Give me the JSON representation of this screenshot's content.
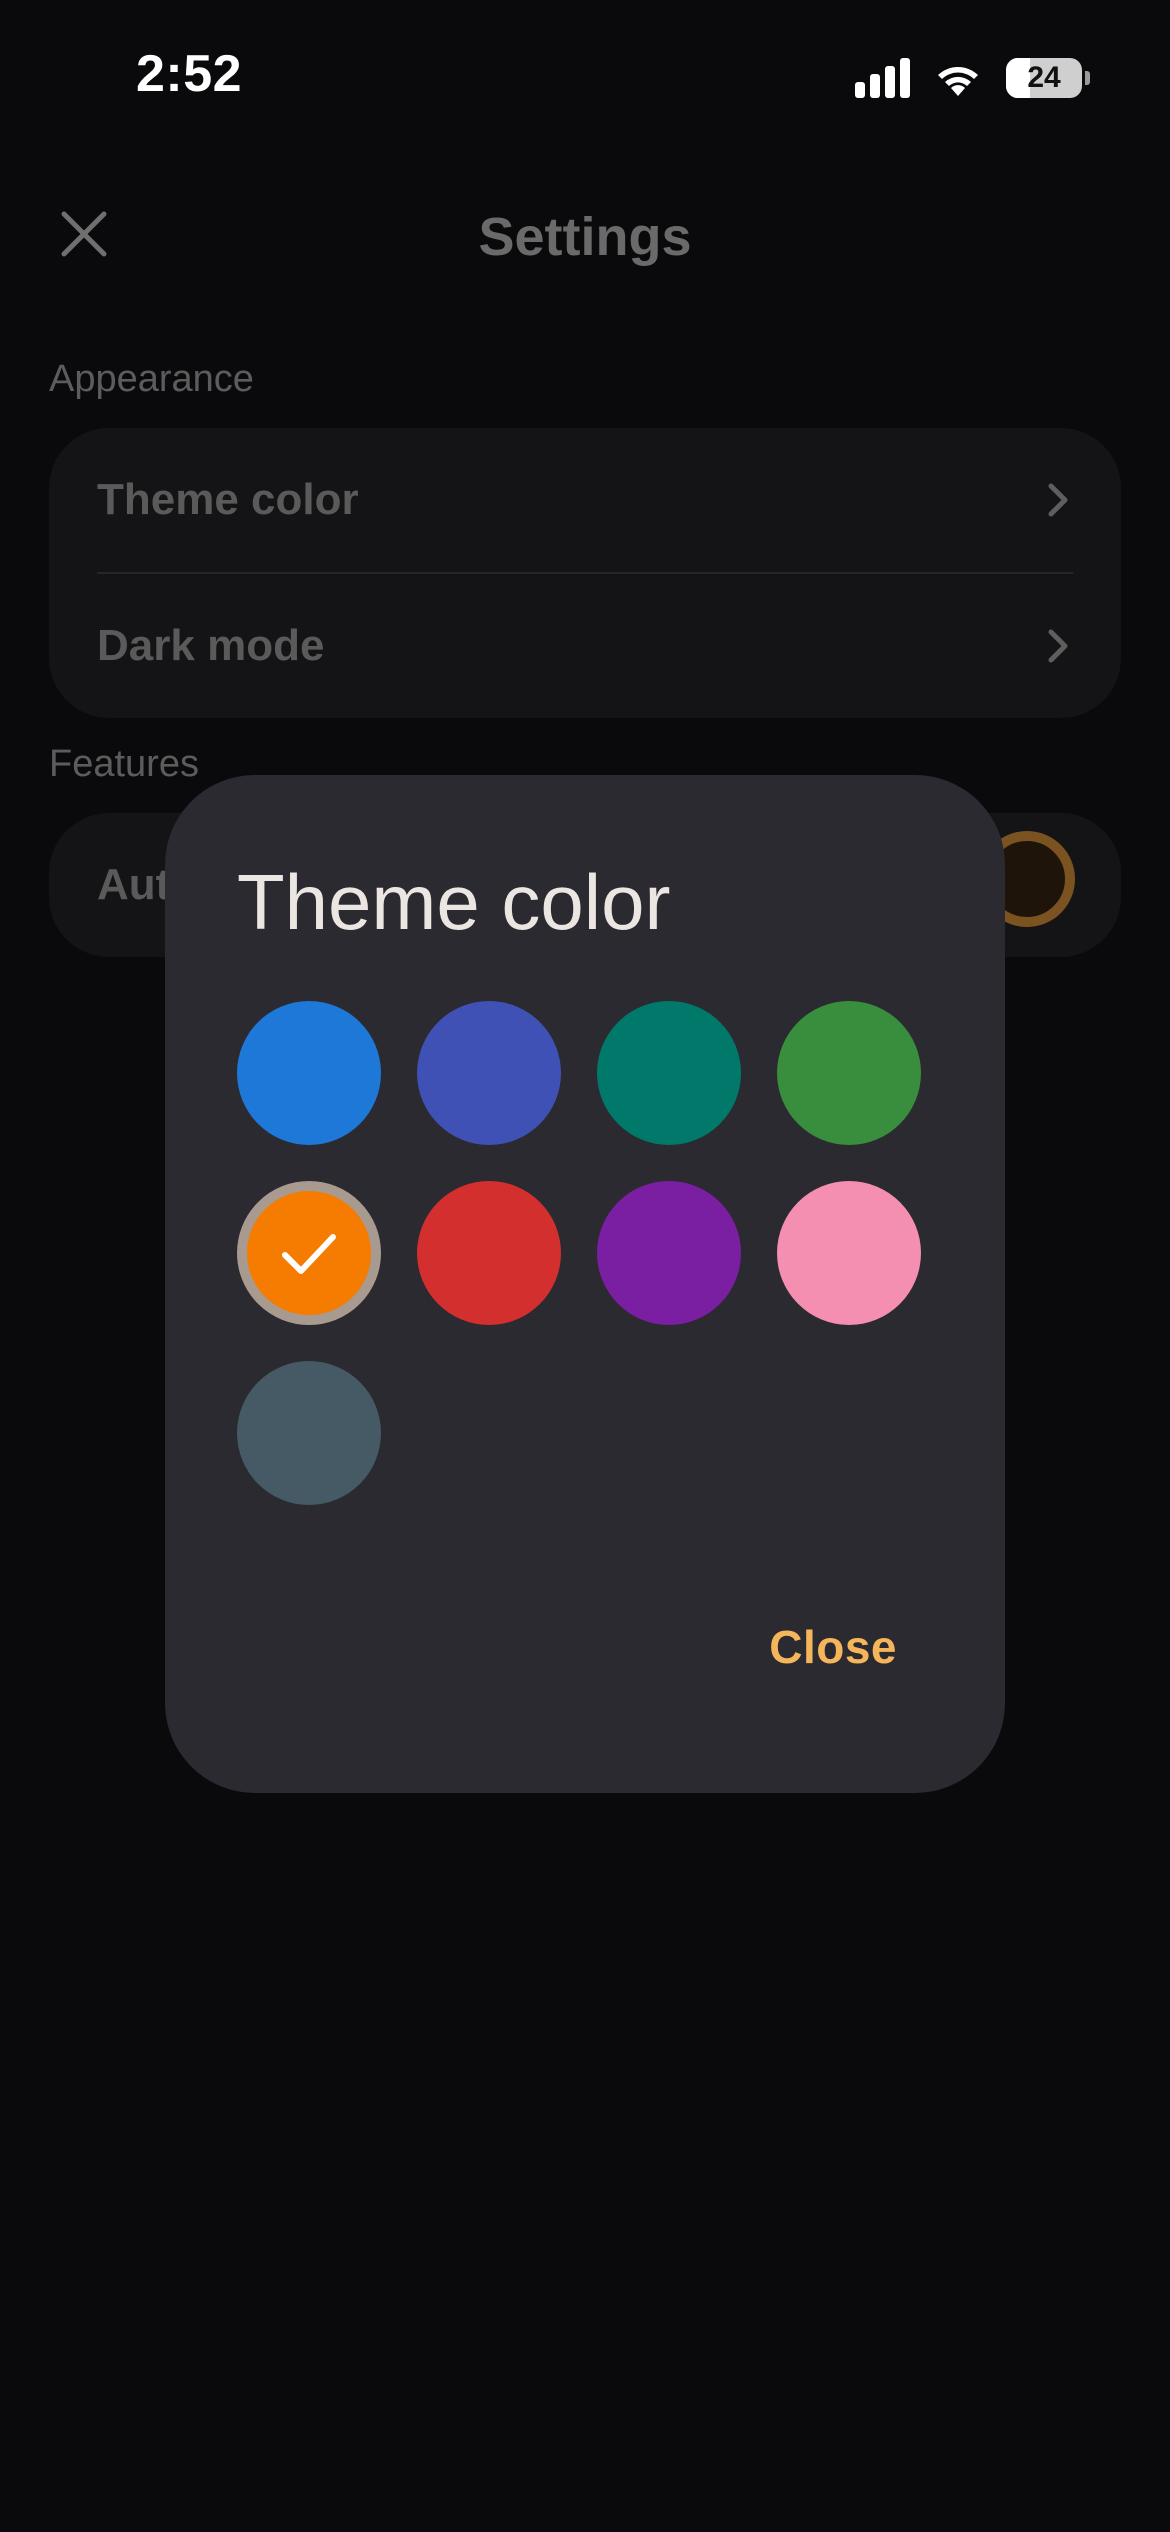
{
  "status_bar": {
    "time": "2:52",
    "battery_level": "24"
  },
  "header": {
    "title": "Settings",
    "close_icon": "close-icon"
  },
  "sections": {
    "appearance": {
      "label": "Appearance",
      "items": [
        {
          "label": "Theme color",
          "icon": "chevron-right-icon"
        },
        {
          "label": "Dark mode",
          "icon": "chevron-right-icon"
        }
      ]
    },
    "features": {
      "label": "Features",
      "items": [
        {
          "label": "Aut"
        }
      ]
    }
  },
  "dialog": {
    "title": "Theme color",
    "close_label": "Close",
    "accent_color": "#f5b55a",
    "swatches": [
      {
        "name": "blue",
        "color": "#1e78d8",
        "selected": false
      },
      {
        "name": "indigo",
        "color": "#4051b5",
        "selected": false
      },
      {
        "name": "teal",
        "color": "#00796b",
        "selected": false
      },
      {
        "name": "green",
        "color": "#388e3c",
        "selected": false
      },
      {
        "name": "orange",
        "color": "#f57c00",
        "selected": true
      },
      {
        "name": "red",
        "color": "#d32f2f",
        "selected": false
      },
      {
        "name": "purple",
        "color": "#7b1fa2",
        "selected": false
      },
      {
        "name": "pink",
        "color": "#f48fb1",
        "selected": false
      },
      {
        "name": "blue-grey",
        "color": "#455a64",
        "selected": false
      }
    ]
  }
}
